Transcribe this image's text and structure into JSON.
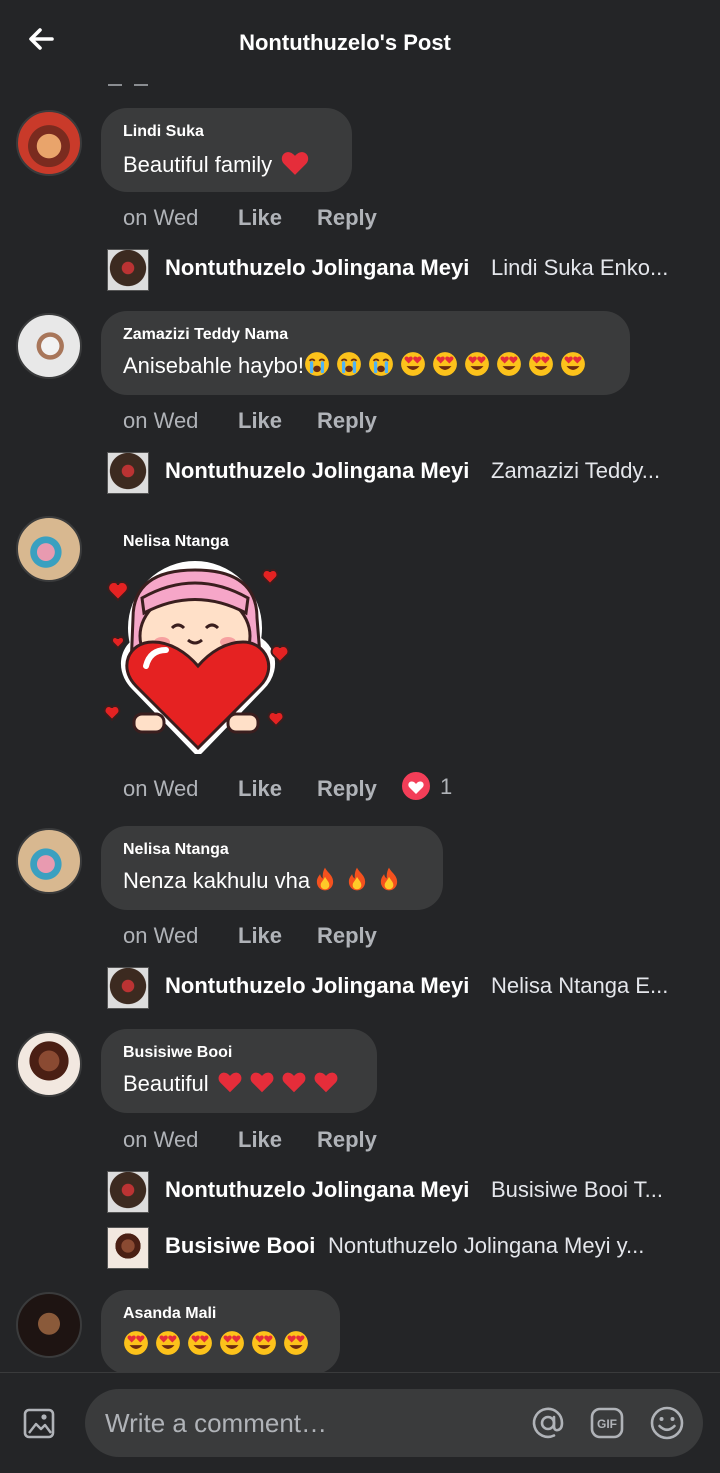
{
  "header": {
    "title": "Nontuthuzelo's Post"
  },
  "comments": [
    {
      "author": "Lindi Suka",
      "text": "Beautiful family",
      "time": "on Wed",
      "like": "Like",
      "reply": "Reply",
      "replies": [
        {
          "name": "Nontuthuzelo Jolingana Meyi",
          "text": "Lindi Suka Enko..."
        }
      ]
    },
    {
      "author": "Zamazizi Teddy Nama",
      "text": "Anisebahle haybo!",
      "time": "on Wed",
      "like": "Like",
      "reply": "Reply",
      "replies": [
        {
          "name": "Nontuthuzelo Jolingana Meyi",
          "text": "Zamazizi Teddy..."
        }
      ]
    },
    {
      "author": "Nelisa Ntanga",
      "sticker": "girl-holding-heart-sticker",
      "time": "on Wed",
      "like": "Like",
      "reply": "Reply",
      "reaction_count": "1"
    },
    {
      "author": "Nelisa Ntanga",
      "text": "Nenza kakhulu vha",
      "time": "on Wed",
      "like": "Like",
      "reply": "Reply",
      "replies": [
        {
          "name": "Nontuthuzelo Jolingana Meyi",
          "text": "Nelisa Ntanga E..."
        }
      ]
    },
    {
      "author": "Busisiwe Booi",
      "text": "Beautiful",
      "time": "on Wed",
      "like": "Like",
      "reply": "Reply",
      "replies": [
        {
          "name": "Nontuthuzelo Jolingana Meyi",
          "text": "Busisiwe Booi T..."
        },
        {
          "name": "Busisiwe Booi",
          "text": "Nontuthuzelo Jolingana Meyi y..."
        }
      ]
    },
    {
      "author": "Asanda Mali",
      "text": ""
    }
  ],
  "composer": {
    "placeholder": "Write a comment…"
  },
  "icons": {
    "back": "arrow-left-icon",
    "photo": "photo-icon",
    "mention": "at-icon",
    "gif": "gif-icon",
    "emoji": "smiley-icon"
  },
  "colors": {
    "background": "#242527",
    "bubble": "#3a3b3c",
    "heart": "#f33e58"
  }
}
